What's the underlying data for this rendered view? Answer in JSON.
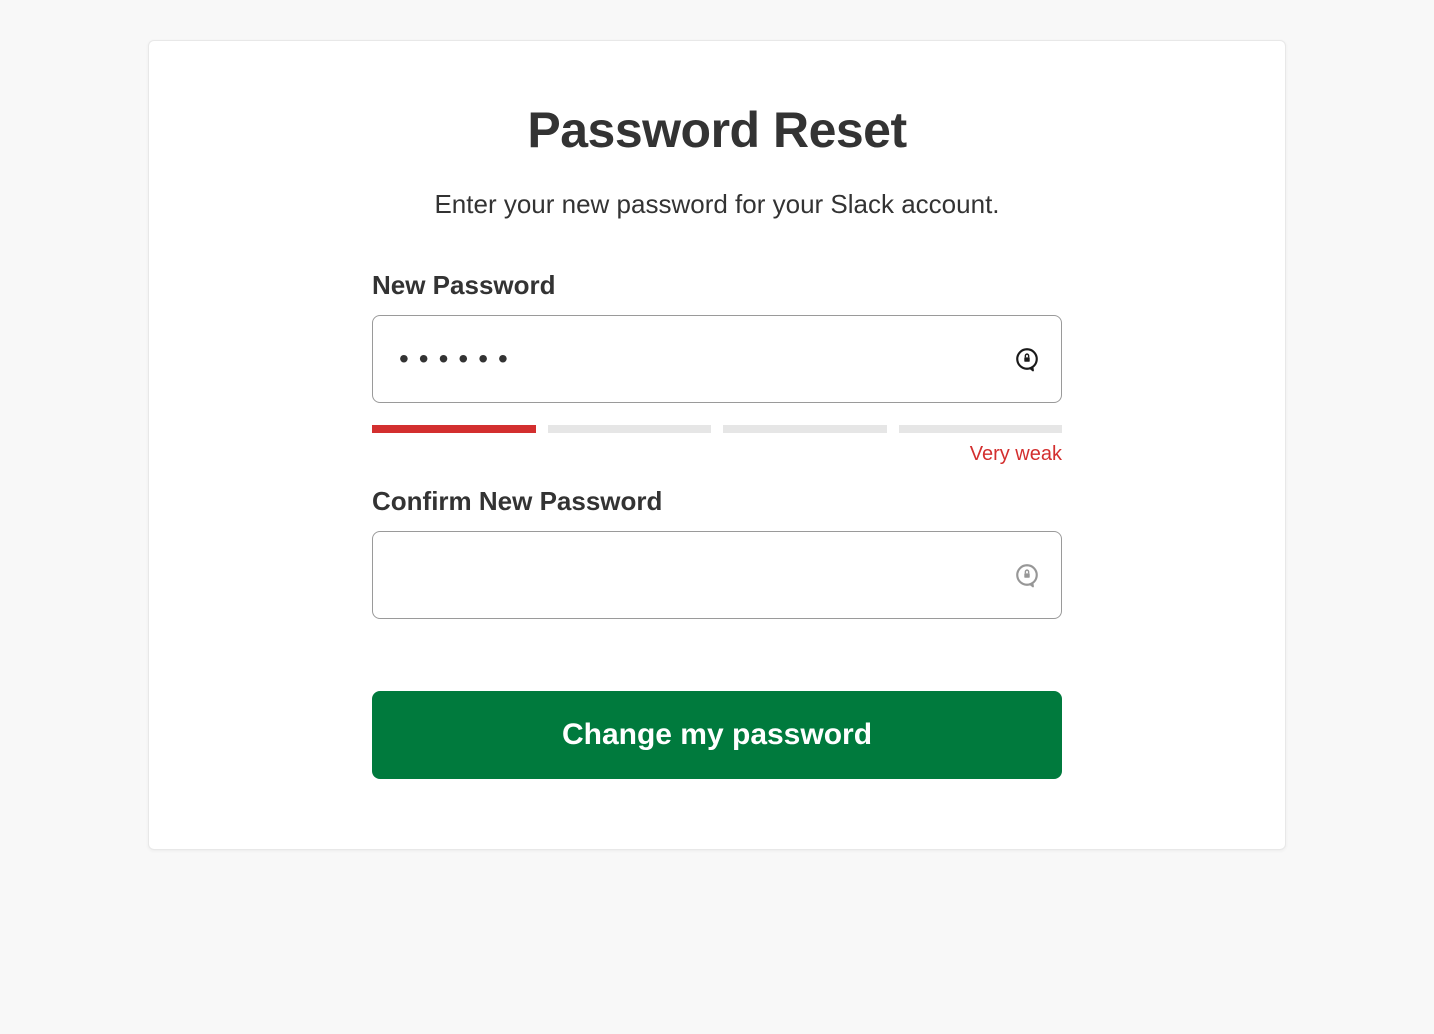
{
  "header": {
    "title": "Password Reset",
    "subtitle": "Enter your new password for your Slack account."
  },
  "form": {
    "new_password": {
      "label": "New Password",
      "value": "••••••"
    },
    "strength": {
      "level": 1,
      "segments": 4,
      "label": "Very weak",
      "colors": {
        "filled": "#d32f2f",
        "empty": "#e6e6e6"
      }
    },
    "confirm_password": {
      "label": "Confirm New Password",
      "value": ""
    },
    "submit_label": "Change my password"
  },
  "colors": {
    "button_bg": "#007a3d",
    "text": "#333333",
    "danger": "#d32f2f"
  }
}
